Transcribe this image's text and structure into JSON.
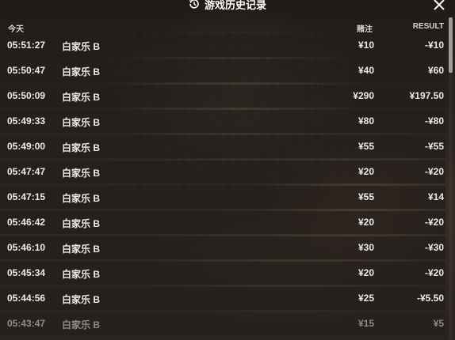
{
  "header": {
    "title": "游戏历史记录",
    "history_icon": "history-clock-icon",
    "close_icon": "close-icon"
  },
  "columns": {
    "date": "今天",
    "bet": "赌注",
    "result": "RESULT"
  },
  "rows": [
    {
      "time": "05:51:27",
      "game": "白家乐 B",
      "bet": "¥10",
      "result": "-¥10"
    },
    {
      "time": "05:50:47",
      "game": "白家乐 B",
      "bet": "¥40",
      "result": "¥60"
    },
    {
      "time": "05:50:09",
      "game": "白家乐 B",
      "bet": "¥290",
      "result": "¥197.50"
    },
    {
      "time": "05:49:33",
      "game": "白家乐 B",
      "bet": "¥80",
      "result": "-¥80"
    },
    {
      "time": "05:49:00",
      "game": "白家乐 B",
      "bet": "¥55",
      "result": "-¥55"
    },
    {
      "time": "05:47:47",
      "game": "白家乐 B",
      "bet": "¥20",
      "result": "-¥20"
    },
    {
      "time": "05:47:15",
      "game": "白家乐 B",
      "bet": "¥55",
      "result": "¥14"
    },
    {
      "time": "05:46:42",
      "game": "白家乐 B",
      "bet": "¥20",
      "result": "-¥20"
    },
    {
      "time": "05:46:10",
      "game": "白家乐 B",
      "bet": "¥30",
      "result": "-¥30"
    },
    {
      "time": "05:45:34",
      "game": "白家乐 B",
      "bet": "¥20",
      "result": "-¥20"
    },
    {
      "time": "05:44:56",
      "game": "白家乐 B",
      "bet": "¥25",
      "result": "-¥5.50"
    },
    {
      "time": "05:43:47",
      "game": "白家乐 B",
      "bet": "¥15",
      "result": "¥5"
    }
  ],
  "colors": {
    "text": "#ecebe8",
    "row_background": "#231f1c",
    "faded_text": "#8f8b86"
  }
}
